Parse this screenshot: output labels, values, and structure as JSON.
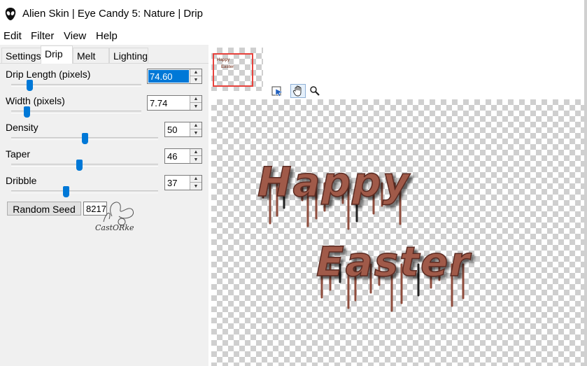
{
  "window": {
    "title": "Alien Skin | Eye Candy 5: Nature | Drip",
    "app_icon": "alien-head-icon"
  },
  "menu": [
    "Edit",
    "Filter",
    "View",
    "Help"
  ],
  "tabs": [
    "Settings",
    "Drip",
    "Melt",
    "Lighting"
  ],
  "active_tab": "Drip",
  "params": {
    "drip_length": {
      "label": "Drip Length (pixels)",
      "value": "74.60",
      "slider_fraction": 0.14
    },
    "width": {
      "label": "Width (pixels)",
      "value": "7.74",
      "slider_fraction": 0.12
    },
    "density": {
      "label": "Density",
      "value": "50",
      "slider_fraction": 0.5
    },
    "taper": {
      "label": "Taper",
      "value": "46",
      "slider_fraction": 0.46
    },
    "dribble": {
      "label": "Dribble",
      "value": "37",
      "slider_fraction": 0.37
    }
  },
  "random_seed": {
    "label": "Random Seed",
    "value": "8217"
  },
  "watermark": "CastORke",
  "toolbar": {
    "navigator_icon": "navigator-icon",
    "hand_icon": "hand-pan-icon",
    "zoom_icon": "zoom-icon"
  },
  "preview": {
    "line1": "Happy",
    "line2": "Easter",
    "text_color": "#a05a48",
    "drip_color": "#8f4c3c"
  },
  "thumbnail": {
    "line1": "Happy",
    "line2": "Easter"
  },
  "colors": {
    "slider_thumb": "#0078d7",
    "selection": "#0078d7",
    "thumb_frame": "#e8423c"
  }
}
